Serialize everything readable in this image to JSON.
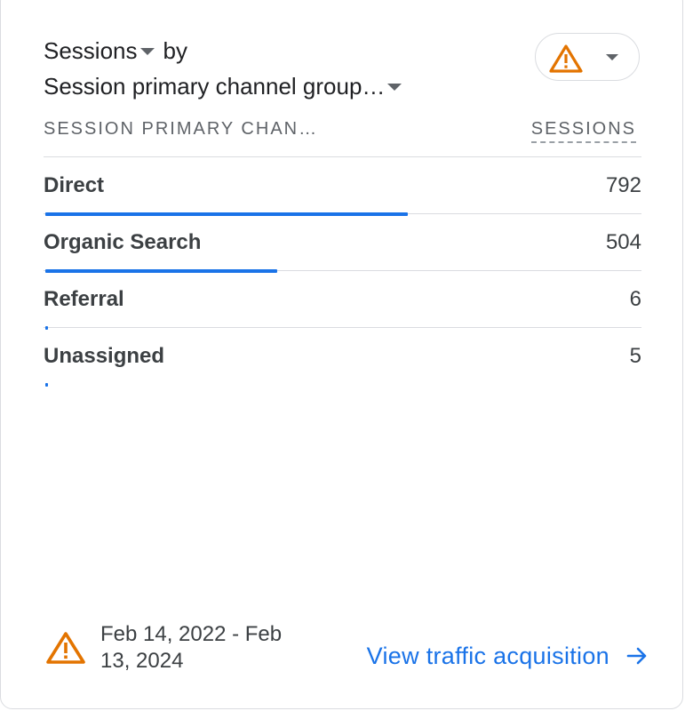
{
  "card": {
    "metric_label": "Sessions",
    "by_label": "by",
    "dimension_label": "Session primary channel group…",
    "warning_color": "#e37400",
    "accent_color": "#1a73e8"
  },
  "table": {
    "header_dimension": "SESSION PRIMARY CHAN…",
    "header_metric": "SESSIONS",
    "max_value": 792,
    "rows": [
      {
        "label": "Direct",
        "value": "792",
        "fraction": 0.61
      },
      {
        "label": "Organic Search",
        "value": "504",
        "fraction": 0.39
      },
      {
        "label": "Referral",
        "value": "6",
        "fraction": 0.005
      },
      {
        "label": "Unassigned",
        "value": "5",
        "fraction": 0.004
      }
    ]
  },
  "footer": {
    "date_range": "Feb 14, 2022 - Feb 13, 2024",
    "link_label": "View traffic acquisition",
    "icons": [
      "warning-icon",
      "arrow-right-icon"
    ]
  }
}
